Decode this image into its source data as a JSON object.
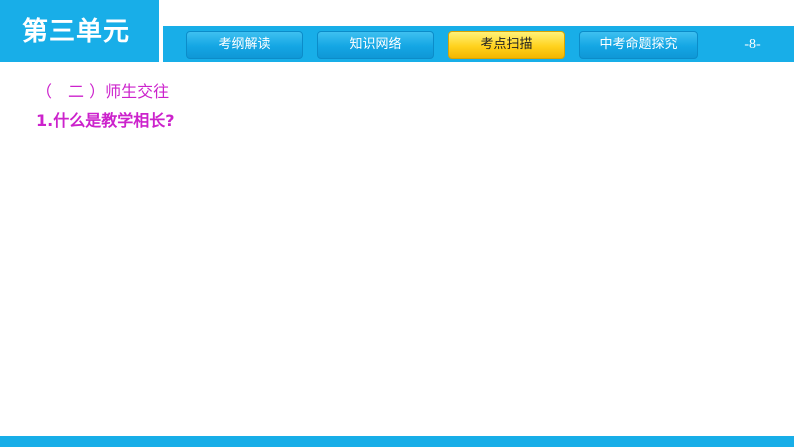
{
  "header": {
    "unit_title": "第三单元",
    "page_number": "-8-"
  },
  "nav": {
    "tabs": [
      {
        "label": "考纲解读",
        "active": false
      },
      {
        "label": "知识网络",
        "active": false
      },
      {
        "label": "考点扫描",
        "active": true
      },
      {
        "label": "中考命题探究",
        "active": false
      }
    ]
  },
  "content": {
    "section_heading": "（　二 ）师生交往",
    "question": "1.什么是教学相长?"
  },
  "colors": {
    "brand_blue": "#18aee8",
    "active_tab": "#ffd21e",
    "text_accent": "#cc22cc"
  }
}
